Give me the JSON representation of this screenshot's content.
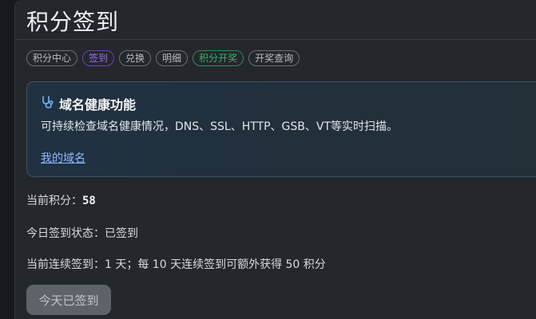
{
  "page": {
    "title": "积分签到"
  },
  "tabs": [
    {
      "label": "积分中心",
      "state": "default"
    },
    {
      "label": "签到",
      "state": "active"
    },
    {
      "label": "兑换",
      "state": "default"
    },
    {
      "label": "明细",
      "state": "default"
    },
    {
      "label": "积分开奖",
      "state": "green"
    },
    {
      "label": "开奖查询",
      "state": "default"
    }
  ],
  "alert": {
    "icon": "stethoscope-icon",
    "title": "域名健康功能",
    "body": "可持续检查域名健康情况，DNS、SSL、HTTP、GSB、VT等实时扫描。",
    "link": "我的域名"
  },
  "stats": {
    "points_label": "当前积分：",
    "points_value": "58",
    "status_text": "今日签到状态：已签到",
    "streak_text": "当前连续签到：1 天；每 10 天连续签到可额外获得 50 积分"
  },
  "checkin_button": {
    "label": "今天已签到",
    "disabled": true
  },
  "colors": {
    "background": "#17191d",
    "panel": "#24272c",
    "active_tab": "#6f42c1",
    "green_tab": "#39b06d",
    "link": "#8fb8ff"
  }
}
